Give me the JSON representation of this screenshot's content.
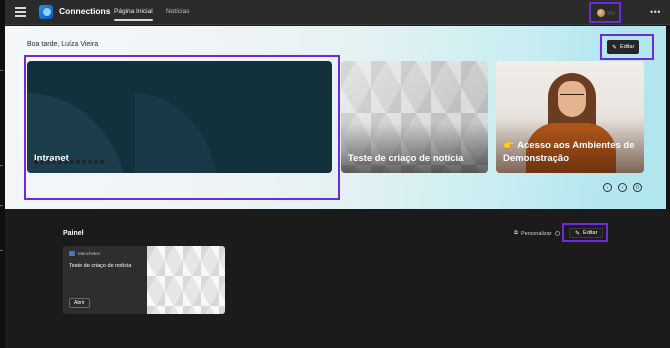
{
  "app": {
    "title": "Connections",
    "logo_icon": "connections-logo-icon",
    "menu_icon": "hamburger-icon",
    "more_icon": "more-horizontal-icon",
    "more_glyph": "•••"
  },
  "nav": {
    "tabs": [
      {
        "label": "Página Inicial",
        "active": true
      },
      {
        "label": "Notícias",
        "active": false
      }
    ]
  },
  "hero": {
    "greeting": "Boa tarde, Luíza Vieira",
    "edit_label": "Editar",
    "cards": [
      {
        "title": "Intranet"
      },
      {
        "title": "Teste de criaço de notícia"
      },
      {
        "title": "👉 Acesso aos Ambientes de Demonstração"
      }
    ],
    "carousel": {
      "total": 12,
      "active_index": 0,
      "prev_glyph": "‹",
      "next_glyph": "›",
      "pause_glyph": "II"
    }
  },
  "panel": {
    "title": "Painel",
    "personalize_label": "Personalizar",
    "edit_label": "Editar",
    "news_card": {
      "source": "Manchetes",
      "headline": "Teste de criaço de notícia",
      "open_label": "Abrir"
    }
  },
  "colors": {
    "highlight": "#6e2bd9",
    "topbar": "#2b2b2b",
    "background": "#1b1b1b",
    "hero_card_dark": "#13303d"
  }
}
